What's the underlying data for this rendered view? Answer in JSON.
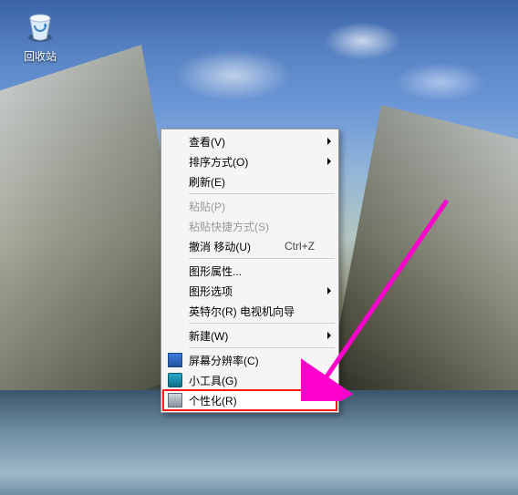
{
  "desktop": {
    "recycle_bin_label": "回收站"
  },
  "menu": {
    "view": {
      "label": "查看(V)"
    },
    "sort": {
      "label": "排序方式(O)"
    },
    "refresh": {
      "label": "刷新(E)"
    },
    "paste": {
      "label": "粘贴(P)"
    },
    "paste_shortcut": {
      "label": "粘贴快捷方式(S)"
    },
    "undo_move": {
      "label": "撤消 移动(U)",
      "shortcut": "Ctrl+Z"
    },
    "graphics_props": {
      "label": "图形属性..."
    },
    "graphics_opts": {
      "label": "图形选项"
    },
    "intel_tv_wizard": {
      "label": "英特尔(R) 电视机向导"
    },
    "new": {
      "label": "新建(W)"
    },
    "resolution": {
      "label": "屏幕分辨率(C)"
    },
    "gadgets": {
      "label": "小工具(G)"
    },
    "personalize": {
      "label": "个性化(R)"
    }
  },
  "annotation": {
    "color": "#ff00cc"
  }
}
